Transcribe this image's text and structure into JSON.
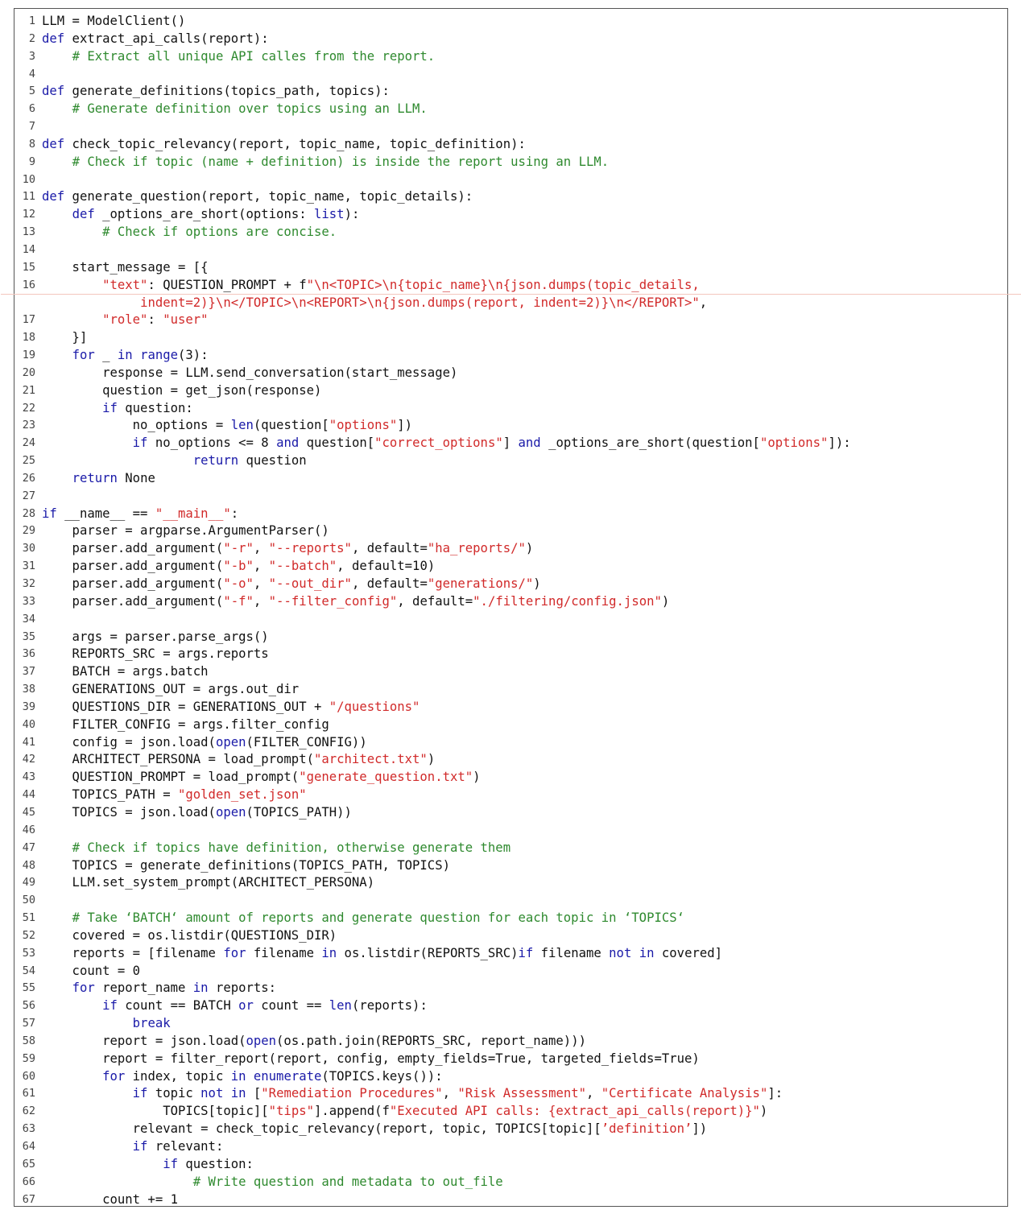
{
  "code_lines": [
    {
      "n": "1",
      "segs": [
        [
          "LLM = ModelClient()",
          ""
        ]
      ]
    },
    {
      "n": "2",
      "segs": [
        [
          "def",
          "kw"
        ],
        [
          " extract_api_calls(report):",
          ""
        ]
      ]
    },
    {
      "n": "3",
      "segs": [
        [
          "    ",
          ""
        ],
        [
          "# Extract all unique API calles from the report.",
          "cm"
        ]
      ]
    },
    {
      "n": "4",
      "segs": []
    },
    {
      "n": "5",
      "segs": [
        [
          "def",
          "kw"
        ],
        [
          " generate_definitions(topics_path, topics):",
          ""
        ]
      ]
    },
    {
      "n": "6",
      "segs": [
        [
          "    ",
          ""
        ],
        [
          "# Generate definition over topics using an LLM.",
          "cm"
        ]
      ]
    },
    {
      "n": "7",
      "segs": []
    },
    {
      "n": "8",
      "segs": [
        [
          "def",
          "kw"
        ],
        [
          " check_topic_relevancy(report, topic_name, topic_definition):",
          ""
        ]
      ]
    },
    {
      "n": "9",
      "segs": [
        [
          "    ",
          ""
        ],
        [
          "# Check if topic (name + definition) is inside the report using an LLM.",
          "cm"
        ]
      ]
    },
    {
      "n": "10",
      "segs": []
    },
    {
      "n": "11",
      "segs": [
        [
          "def",
          "kw"
        ],
        [
          " generate_question(report, topic_name, topic_details):",
          ""
        ]
      ]
    },
    {
      "n": "12",
      "segs": [
        [
          "    ",
          ""
        ],
        [
          "def",
          "kw"
        ],
        [
          " _options_are_short(options: ",
          ""
        ],
        [
          "list",
          "kw"
        ],
        [
          "):",
          ""
        ]
      ]
    },
    {
      "n": "13",
      "segs": [
        [
          "        ",
          ""
        ],
        [
          "# Check if options are concise.",
          "cm"
        ]
      ]
    },
    {
      "n": "14",
      "segs": []
    },
    {
      "n": "15",
      "segs": [
        [
          "    start_message = [{",
          ""
        ]
      ]
    },
    {
      "n": "16",
      "tall": true,
      "segs": [
        [
          "        ",
          ""
        ],
        [
          "\"text\"",
          "st"
        ],
        [
          ": QUESTION_PROMPT + f",
          ""
        ],
        [
          "\"\\n<TOPIC>\\n{topic_name}\\n{json.dumps(topic_details,\n             indent=2)}\\n</TOPIC>\\n<REPORT>\\n{json.dumps(report, indent=2)}\\n</REPORT>\"",
          "st"
        ],
        [
          ",",
          ""
        ]
      ]
    },
    {
      "n": "17",
      "segs": [
        [
          "        ",
          ""
        ],
        [
          "\"role\"",
          "st"
        ],
        [
          ": ",
          ""
        ],
        [
          "\"user\"",
          "st"
        ]
      ]
    },
    {
      "n": "18",
      "segs": [
        [
          "    }]",
          ""
        ]
      ]
    },
    {
      "n": "19",
      "segs": [
        [
          "    ",
          ""
        ],
        [
          "for",
          "kw"
        ],
        [
          " _ ",
          ""
        ],
        [
          "in",
          "kw"
        ],
        [
          " ",
          ""
        ],
        [
          "range",
          "kw"
        ],
        [
          "(3):",
          ""
        ]
      ]
    },
    {
      "n": "20",
      "segs": [
        [
          "        response = LLM.send_conversation(start_message)",
          ""
        ]
      ]
    },
    {
      "n": "21",
      "segs": [
        [
          "        question = get_json(response)",
          ""
        ]
      ]
    },
    {
      "n": "22",
      "segs": [
        [
          "        ",
          ""
        ],
        [
          "if",
          "kw"
        ],
        [
          " question:",
          ""
        ]
      ]
    },
    {
      "n": "23",
      "segs": [
        [
          "            no_options = ",
          ""
        ],
        [
          "len",
          "kw"
        ],
        [
          "(question[",
          ""
        ],
        [
          "\"options\"",
          "st"
        ],
        [
          "])",
          ""
        ]
      ]
    },
    {
      "n": "24",
      "segs": [
        [
          "            ",
          ""
        ],
        [
          "if",
          "kw"
        ],
        [
          " no_options <= 8 ",
          ""
        ],
        [
          "and",
          "kw"
        ],
        [
          " question[",
          ""
        ],
        [
          "\"correct_options\"",
          "st"
        ],
        [
          "] ",
          ""
        ],
        [
          "and",
          "kw"
        ],
        [
          " _options_are_short(question[",
          ""
        ],
        [
          "\"options\"",
          "st"
        ],
        [
          "]):",
          ""
        ]
      ]
    },
    {
      "n": "25",
      "segs": [
        [
          "                    ",
          ""
        ],
        [
          "return",
          "kw"
        ],
        [
          " question",
          ""
        ]
      ]
    },
    {
      "n": "26",
      "segs": [
        [
          "    ",
          ""
        ],
        [
          "return",
          "kw"
        ],
        [
          " None",
          ""
        ]
      ]
    },
    {
      "n": "27",
      "segs": []
    },
    {
      "n": "28",
      "segs": [
        [
          "if",
          "kw"
        ],
        [
          " __name__ == ",
          ""
        ],
        [
          "\"__main__\"",
          "st"
        ],
        [
          ":",
          ""
        ]
      ]
    },
    {
      "n": "29",
      "segs": [
        [
          "    parser = argparse.ArgumentParser()",
          ""
        ]
      ]
    },
    {
      "n": "30",
      "segs": [
        [
          "    parser.add_argument(",
          ""
        ],
        [
          "\"-r\"",
          "st"
        ],
        [
          ", ",
          ""
        ],
        [
          "\"--reports\"",
          "st"
        ],
        [
          ", default=",
          ""
        ],
        [
          "\"ha_reports/\"",
          "st"
        ],
        [
          ")",
          ""
        ]
      ]
    },
    {
      "n": "31",
      "segs": [
        [
          "    parser.add_argument(",
          ""
        ],
        [
          "\"-b\"",
          "st"
        ],
        [
          ", ",
          ""
        ],
        [
          "\"--batch\"",
          "st"
        ],
        [
          ", default=10)",
          ""
        ]
      ]
    },
    {
      "n": "32",
      "segs": [
        [
          "    parser.add_argument(",
          ""
        ],
        [
          "\"-o\"",
          "st"
        ],
        [
          ", ",
          ""
        ],
        [
          "\"--out_dir\"",
          "st"
        ],
        [
          ", default=",
          ""
        ],
        [
          "\"generations/\"",
          "st"
        ],
        [
          ")",
          ""
        ]
      ]
    },
    {
      "n": "33",
      "segs": [
        [
          "    parser.add_argument(",
          ""
        ],
        [
          "\"-f\"",
          "st"
        ],
        [
          ", ",
          ""
        ],
        [
          "\"--filter_config\"",
          "st"
        ],
        [
          ", default=",
          ""
        ],
        [
          "\"./filtering/config.json\"",
          "st"
        ],
        [
          ")",
          ""
        ]
      ]
    },
    {
      "n": "34",
      "segs": []
    },
    {
      "n": "35",
      "segs": [
        [
          "    args = parser.parse_args()",
          ""
        ]
      ]
    },
    {
      "n": "36",
      "segs": [
        [
          "    REPORTS_SRC = args.reports",
          ""
        ]
      ]
    },
    {
      "n": "37",
      "segs": [
        [
          "    BATCH = args.batch",
          ""
        ]
      ]
    },
    {
      "n": "38",
      "segs": [
        [
          "    GENERATIONS_OUT = args.out_dir",
          ""
        ]
      ]
    },
    {
      "n": "39",
      "segs": [
        [
          "    QUESTIONS_DIR = GENERATIONS_OUT + ",
          ""
        ],
        [
          "\"/questions\"",
          "st"
        ]
      ]
    },
    {
      "n": "40",
      "segs": [
        [
          "    FILTER_CONFIG = args.filter_config",
          ""
        ]
      ]
    },
    {
      "n": "41",
      "segs": [
        [
          "    config = json.load(",
          ""
        ],
        [
          "open",
          "kw"
        ],
        [
          "(FILTER_CONFIG))",
          ""
        ]
      ]
    },
    {
      "n": "42",
      "segs": [
        [
          "    ARCHITECT_PERSONA = load_prompt(",
          ""
        ],
        [
          "\"architect.txt\"",
          "st"
        ],
        [
          ")",
          ""
        ]
      ]
    },
    {
      "n": "43",
      "segs": [
        [
          "    QUESTION_PROMPT = load_prompt(",
          ""
        ],
        [
          "\"generate_question.txt\"",
          "st"
        ],
        [
          ")",
          ""
        ]
      ]
    },
    {
      "n": "44",
      "segs": [
        [
          "    TOPICS_PATH = ",
          ""
        ],
        [
          "\"golden_set.json\"",
          "st"
        ]
      ]
    },
    {
      "n": "45",
      "segs": [
        [
          "    TOPICS = json.load(",
          ""
        ],
        [
          "open",
          "kw"
        ],
        [
          "(TOPICS_PATH))",
          ""
        ]
      ]
    },
    {
      "n": "46",
      "segs": []
    },
    {
      "n": "47",
      "segs": [
        [
          "    ",
          ""
        ],
        [
          "# Check if topics have definition, otherwise generate them",
          "cm"
        ]
      ]
    },
    {
      "n": "48",
      "segs": [
        [
          "    TOPICS = generate_definitions(TOPICS_PATH, TOPICS)",
          ""
        ]
      ]
    },
    {
      "n": "49",
      "segs": [
        [
          "    LLM.set_system_prompt(ARCHITECT_PERSONA)",
          ""
        ]
      ]
    },
    {
      "n": "50",
      "segs": []
    },
    {
      "n": "51",
      "segs": [
        [
          "    ",
          ""
        ],
        [
          "# Take ‘BATCH‘ amount of reports and generate question for each topic in ‘TOPICS‘",
          "cm"
        ]
      ]
    },
    {
      "n": "52",
      "segs": [
        [
          "    covered = os.listdir(QUESTIONS_DIR)",
          ""
        ]
      ]
    },
    {
      "n": "53",
      "segs": [
        [
          "    reports = [filename ",
          ""
        ],
        [
          "for",
          "kw"
        ],
        [
          " filename ",
          ""
        ],
        [
          "in",
          "kw"
        ],
        [
          " os.listdir(REPORTS_SRC)",
          ""
        ],
        [
          "if",
          "kw"
        ],
        [
          " filename ",
          ""
        ],
        [
          "not",
          "kw"
        ],
        [
          " ",
          ""
        ],
        [
          "in",
          "kw"
        ],
        [
          " covered]",
          ""
        ]
      ]
    },
    {
      "n": "54",
      "segs": [
        [
          "    count = 0",
          ""
        ]
      ]
    },
    {
      "n": "55",
      "segs": [
        [
          "    ",
          ""
        ],
        [
          "for",
          "kw"
        ],
        [
          " report_name ",
          ""
        ],
        [
          "in",
          "kw"
        ],
        [
          " reports:",
          ""
        ]
      ]
    },
    {
      "n": "56",
      "segs": [
        [
          "        ",
          ""
        ],
        [
          "if",
          "kw"
        ],
        [
          " count == BATCH ",
          ""
        ],
        [
          "or",
          "kw"
        ],
        [
          " count == ",
          ""
        ],
        [
          "len",
          "kw"
        ],
        [
          "(reports):",
          ""
        ]
      ]
    },
    {
      "n": "57",
      "segs": [
        [
          "            ",
          ""
        ],
        [
          "break",
          "kw"
        ]
      ]
    },
    {
      "n": "58",
      "segs": [
        [
          "        report = json.load(",
          ""
        ],
        [
          "open",
          "kw"
        ],
        [
          "(os.path.join(REPORTS_SRC, report_name)))",
          ""
        ]
      ]
    },
    {
      "n": "59",
      "segs": [
        [
          "        report = filter_report(report, config, empty_fields=True, targeted_fields=True)",
          ""
        ]
      ]
    },
    {
      "n": "60",
      "segs": [
        [
          "        ",
          ""
        ],
        [
          "for",
          "kw"
        ],
        [
          " index, topic ",
          ""
        ],
        [
          "in",
          "kw"
        ],
        [
          " ",
          ""
        ],
        [
          "enumerate",
          "kw"
        ],
        [
          "(TOPICS.keys()):",
          ""
        ]
      ]
    },
    {
      "n": "61",
      "segs": [
        [
          "            ",
          ""
        ],
        [
          "if",
          "kw"
        ],
        [
          " topic ",
          ""
        ],
        [
          "not",
          "kw"
        ],
        [
          " ",
          ""
        ],
        [
          "in",
          "kw"
        ],
        [
          " [",
          ""
        ],
        [
          "\"Remediation Procedures\"",
          "st"
        ],
        [
          ", ",
          ""
        ],
        [
          "\"Risk Assessment\"",
          "st"
        ],
        [
          ", ",
          ""
        ],
        [
          "\"Certificate Analysis\"",
          "st"
        ],
        [
          "]:",
          ""
        ]
      ]
    },
    {
      "n": "62",
      "segs": [
        [
          "                TOPICS[topic][",
          ""
        ],
        [
          "\"tips\"",
          "st"
        ],
        [
          "].append(f",
          ""
        ],
        [
          "\"Executed API calls: {extract_api_calls(report)}\"",
          "st"
        ],
        [
          ")",
          ""
        ]
      ]
    },
    {
      "n": "63",
      "segs": [
        [
          "            relevant = check_topic_relevancy(report, topic, TOPICS[topic][",
          ""
        ],
        [
          "’definition’",
          "st"
        ],
        [
          "])",
          ""
        ]
      ]
    },
    {
      "n": "64",
      "segs": [
        [
          "            ",
          ""
        ],
        [
          "if",
          "kw"
        ],
        [
          " relevant:",
          ""
        ]
      ]
    },
    {
      "n": "65",
      "segs": [
        [
          "                ",
          ""
        ],
        [
          "if",
          "kw"
        ],
        [
          " question:",
          ""
        ]
      ]
    },
    {
      "n": "66",
      "segs": [
        [
          "                    ",
          ""
        ],
        [
          "# Write question and metadata to out_file",
          "cm"
        ]
      ]
    },
    {
      "n": "67",
      "segs": [
        [
          "        count += 1",
          ""
        ]
      ]
    }
  ]
}
